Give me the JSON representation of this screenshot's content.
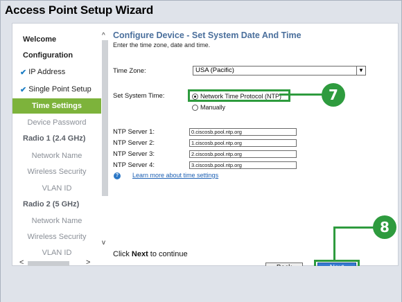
{
  "window": {
    "title": "Access Point Setup Wizard"
  },
  "sidebar": {
    "items": [
      {
        "label": "Welcome",
        "type": "head"
      },
      {
        "label": "Configuration",
        "type": "head"
      },
      {
        "label": "IP Address",
        "type": "done"
      },
      {
        "label": "Single Point Setup",
        "type": "done"
      },
      {
        "label": "Time Settings",
        "type": "active"
      },
      {
        "label": "Device Password",
        "type": "sub"
      },
      {
        "label": "Radio 1 (2.4 GHz)",
        "type": "head2"
      },
      {
        "label": "Network Name",
        "type": "sub"
      },
      {
        "label": "Wireless Security",
        "type": "sub"
      },
      {
        "label": "VLAN ID",
        "type": "sub"
      },
      {
        "label": "Radio 2 (5 GHz)",
        "type": "head2"
      },
      {
        "label": "Network Name",
        "type": "sub"
      },
      {
        "label": "Wireless Security",
        "type": "sub"
      },
      {
        "label": "VLAN ID",
        "type": "sub"
      }
    ],
    "check_glyph": "✔"
  },
  "content": {
    "heading": "Configure Device - Set System Date And Time",
    "subheading": "Enter the time zone, date and time.",
    "timezone": {
      "label": "Time Zone:",
      "value": "USA (Pacific)"
    },
    "system_time": {
      "label": "Set System Time:",
      "options": [
        {
          "label": "Network Time Protocol (NTP)",
          "selected": true
        },
        {
          "label": "Manually",
          "selected": false
        }
      ]
    },
    "ntp_servers": [
      {
        "label": "NTP Server 1:",
        "value": "0.ciscosb.pool.ntp.org"
      },
      {
        "label": "NTP Server 2:",
        "value": "1.ciscosb.pool.ntp.org"
      },
      {
        "label": "NTP Server 3:",
        "value": "2.ciscosb.pool.ntp.org"
      },
      {
        "label": "NTP Server 4:",
        "value": "3.ciscosb.pool.ntp.org"
      }
    ],
    "help_icon": "?",
    "learn_more": "Learn more about time settings",
    "continue_prefix": "Click ",
    "continue_bold": "Next",
    "continue_suffix": " to continue"
  },
  "buttons": {
    "back": "Back",
    "next": "Next"
  },
  "callouts": {
    "ntp": "7",
    "next": "8"
  },
  "colors": {
    "accent_green": "#2e9b3e",
    "active_nav": "#7db33b",
    "heading_blue": "#4a6f9c",
    "next_blue": "#1e5fb4"
  }
}
